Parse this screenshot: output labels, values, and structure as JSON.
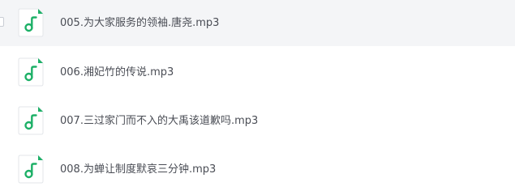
{
  "file_list": {
    "icon": "audio-file-icon",
    "accent_color": "#1db067",
    "hovered_row_background": "#f4f5f7",
    "items": [
      {
        "name": "005.为大家服务的领袖.唐尧.mp3",
        "hovered": true
      },
      {
        "name": "006.湘妃竹的传说.mp3",
        "hovered": false
      },
      {
        "name": "007.三过家门而不入的大禹该道歉吗.mp3",
        "hovered": false
      },
      {
        "name": "008.为蝉让制度默哀三分钟.mp3",
        "hovered": false
      }
    ]
  }
}
